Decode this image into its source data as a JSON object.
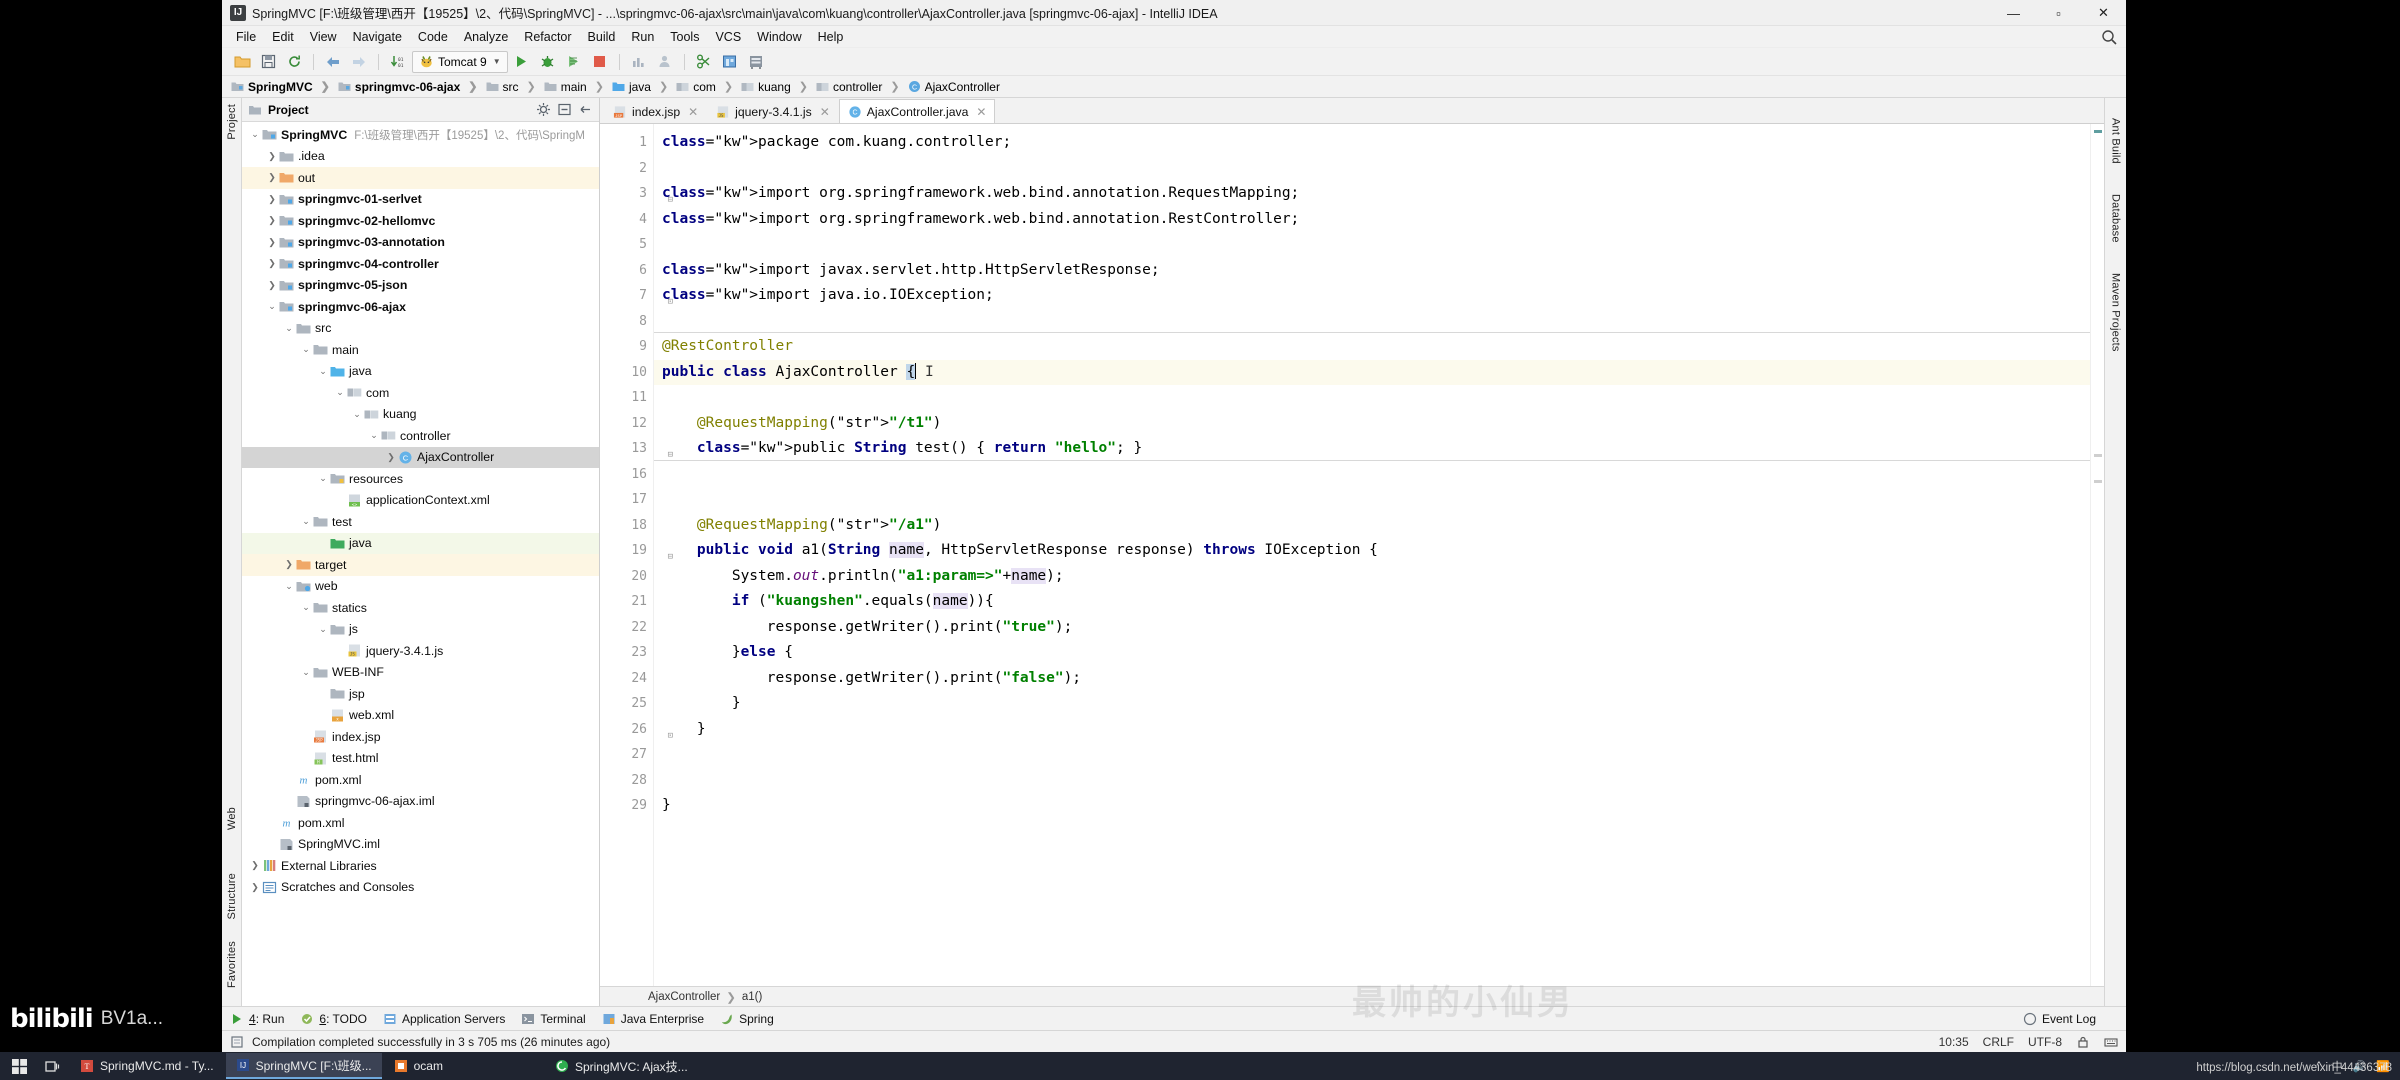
{
  "window": {
    "title": "SpringMVC [F:\\班级管理\\西开【19525】\\2、代码\\SpringMVC] - ...\\springmvc-06-ajax\\src\\main\\java\\com\\kuang\\controller\\AjaxController.java [springmvc-06-ajax] - IntelliJ IDEA",
    "icon_text": "IJ",
    "minimize": "—",
    "maximize": "▫",
    "close": "✕"
  },
  "menu": {
    "items": [
      "File",
      "Edit",
      "View",
      "Navigate",
      "Code",
      "Analyze",
      "Refactor",
      "Build",
      "Run",
      "Tools",
      "VCS",
      "Window",
      "Help"
    ],
    "search_icon": "search-icon"
  },
  "toolbar": {
    "buttons": [
      {
        "name": "open-folder-icon",
        "glyph": "folder"
      },
      {
        "name": "save-all-icon",
        "glyph": "save"
      },
      {
        "name": "sync-refresh-icon",
        "glyph": "sync"
      },
      {
        "name": "back-arrow-icon",
        "glyph": "back"
      },
      {
        "name": "forward-arrow-icon",
        "glyph": "forward"
      },
      {
        "name": "update-project-icon",
        "glyph": "update"
      }
    ],
    "run_config": "Tomcat 9",
    "run_config_icon": "tomcat-cat-icon",
    "actions": [
      {
        "name": "run-button",
        "glyph": "run"
      },
      {
        "name": "debug-button",
        "glyph": "debug"
      },
      {
        "name": "run-with-coverage-button",
        "glyph": "coverage"
      },
      {
        "name": "stop-button",
        "glyph": "stop"
      },
      {
        "name": "profiler-button",
        "glyph": "profile"
      },
      {
        "name": "attach-profiler-button",
        "glyph": "attach"
      },
      {
        "name": "vcs-update-button",
        "glyph": "vcsupdate"
      },
      {
        "name": "commit-button",
        "glyph": "commit"
      },
      {
        "name": "database-button",
        "glyph": "db"
      }
    ]
  },
  "navbar": {
    "crumbs": [
      {
        "label": "SpringMVC",
        "icon": "module-icon",
        "bold": true
      },
      {
        "label": "springmvc-06-ajax",
        "icon": "module-icon",
        "bold": true
      },
      {
        "label": "src",
        "icon": "folder-icon",
        "bold": false
      },
      {
        "label": "main",
        "icon": "folder-icon",
        "bold": false
      },
      {
        "label": "java",
        "icon": "source-folder-icon",
        "bold": false
      },
      {
        "label": "com",
        "icon": "package-icon",
        "bold": false
      },
      {
        "label": "kuang",
        "icon": "package-icon",
        "bold": false
      },
      {
        "label": "controller",
        "icon": "package-icon",
        "bold": false
      },
      {
        "label": "AjaxController",
        "icon": "java-class-icon",
        "bold": false
      }
    ]
  },
  "left_strips": {
    "top": [
      "Project"
    ],
    "bottom": [
      "Structure",
      "Favorites"
    ],
    "web_label": "Web"
  },
  "right_strip": {
    "items": [
      "Ant Build",
      "Database",
      "Maven Projects"
    ]
  },
  "project_panel": {
    "title": "Project",
    "buttons": [
      "settings-icon",
      "collapse-all-icon",
      "hide-icon"
    ],
    "tree": [
      {
        "depth": 0,
        "twisty": "open",
        "icon": "module-icon",
        "label": "SpringMVC",
        "bold": true,
        "path": "F:\\班级管理\\西开【19525】\\2、代码\\SpringM"
      },
      {
        "depth": 1,
        "twisty": "closed",
        "icon": "folder-icon",
        "label": ".idea",
        "bold": false
      },
      {
        "depth": 1,
        "twisty": "closed",
        "icon": "excluded-folder-icon",
        "label": "out",
        "bold": false,
        "hl": "orange"
      },
      {
        "depth": 1,
        "twisty": "closed",
        "icon": "module-icon",
        "label": "springmvc-01-serlvet",
        "bold": true
      },
      {
        "depth": 1,
        "twisty": "closed",
        "icon": "module-icon",
        "label": "springmvc-02-hellomvc",
        "bold": true
      },
      {
        "depth": 1,
        "twisty": "closed",
        "icon": "module-icon",
        "label": "springmvc-03-annotation",
        "bold": true
      },
      {
        "depth": 1,
        "twisty": "closed",
        "icon": "module-icon",
        "label": "springmvc-04-controller",
        "bold": true
      },
      {
        "depth": 1,
        "twisty": "closed",
        "icon": "module-icon",
        "label": "springmvc-05-json",
        "bold": true
      },
      {
        "depth": 1,
        "twisty": "open",
        "icon": "module-icon",
        "label": "springmvc-06-ajax",
        "bold": true
      },
      {
        "depth": 2,
        "twisty": "open",
        "icon": "folder-icon",
        "label": "src",
        "bold": false
      },
      {
        "depth": 3,
        "twisty": "open",
        "icon": "folder-icon",
        "label": "main",
        "bold": false
      },
      {
        "depth": 4,
        "twisty": "open",
        "icon": "source-folder-icon",
        "label": "java",
        "bold": false
      },
      {
        "depth": 5,
        "twisty": "open",
        "icon": "package-icon",
        "label": "com",
        "bold": false
      },
      {
        "depth": 6,
        "twisty": "open",
        "icon": "package-icon",
        "label": "kuang",
        "bold": false
      },
      {
        "depth": 7,
        "twisty": "open",
        "icon": "package-icon",
        "label": "controller",
        "bold": false
      },
      {
        "depth": 8,
        "twisty": "closed",
        "icon": "java-class-icon",
        "label": "AjaxController",
        "bold": false,
        "selected": true
      },
      {
        "depth": 4,
        "twisty": "open",
        "icon": "resource-folder-icon",
        "label": "resources",
        "bold": false
      },
      {
        "depth": 5,
        "twisty": "none",
        "icon": "xml-spring-icon",
        "label": "applicationContext.xml",
        "bold": false
      },
      {
        "depth": 3,
        "twisty": "open",
        "icon": "folder-icon",
        "label": "test",
        "bold": false
      },
      {
        "depth": 4,
        "twisty": "none",
        "icon": "test-source-folder-icon",
        "label": "java",
        "bold": false,
        "hl": "green"
      },
      {
        "depth": 2,
        "twisty": "closed",
        "icon": "excluded-folder-icon",
        "label": "target",
        "bold": false,
        "hl": "orange"
      },
      {
        "depth": 2,
        "twisty": "open",
        "icon": "web-folder-icon",
        "label": "web",
        "bold": false
      },
      {
        "depth": 3,
        "twisty": "open",
        "icon": "folder-icon",
        "label": "statics",
        "bold": false
      },
      {
        "depth": 4,
        "twisty": "open",
        "icon": "folder-icon",
        "label": "js",
        "bold": false
      },
      {
        "depth": 5,
        "twisty": "none",
        "icon": "js-file-icon",
        "label": "jquery-3.4.1.js",
        "bold": false
      },
      {
        "depth": 3,
        "twisty": "open",
        "icon": "folder-icon",
        "label": "WEB-INF",
        "bold": false
      },
      {
        "depth": 4,
        "twisty": "none",
        "icon": "folder-icon",
        "label": "jsp",
        "bold": false
      },
      {
        "depth": 4,
        "twisty": "none",
        "icon": "xml-file-icon",
        "label": "web.xml",
        "bold": false
      },
      {
        "depth": 3,
        "twisty": "none",
        "icon": "jsp-file-icon",
        "label": "index.jsp",
        "bold": false
      },
      {
        "depth": 3,
        "twisty": "none",
        "icon": "html-file-icon",
        "label": "test.html",
        "bold": false
      },
      {
        "depth": 2,
        "twisty": "none",
        "icon": "maven-pom-icon",
        "label": "pom.xml",
        "bold": false
      },
      {
        "depth": 2,
        "twisty": "none",
        "icon": "iml-file-icon",
        "label": "springmvc-06-ajax.iml",
        "bold": false
      },
      {
        "depth": 1,
        "twisty": "none",
        "icon": "maven-pom-icon",
        "label": "pom.xml",
        "bold": false
      },
      {
        "depth": 1,
        "twisty": "none",
        "icon": "iml-file-icon",
        "label": "SpringMVC.iml",
        "bold": false
      },
      {
        "depth": 0,
        "twisty": "closed",
        "icon": "external-libraries-icon",
        "label": "External Libraries",
        "bold": false
      },
      {
        "depth": 0,
        "twisty": "closed",
        "icon": "scratches-icon",
        "label": "Scratches and Consoles",
        "bold": false
      }
    ]
  },
  "editor": {
    "tabs": [
      {
        "label": "index.jsp",
        "icon": "jsp-file-icon",
        "active": false
      },
      {
        "label": "jquery-3.4.1.js",
        "icon": "js-file-icon",
        "active": false
      },
      {
        "label": "AjaxController.java",
        "icon": "java-class-icon",
        "active": true
      }
    ],
    "line_numbers": [
      "1",
      "2",
      "3",
      "4",
      "5",
      "6",
      "7",
      "8",
      "9",
      "10",
      "11",
      "12",
      "13",
      "16",
      "17",
      "18",
      "19",
      "20",
      "21",
      "22",
      "23",
      "24",
      "25",
      "26",
      "27",
      "28",
      "29"
    ],
    "lines": [
      "package com.kuang.controller;",
      "",
      "import org.springframework.web.bind.annotation.RequestMapping;",
      "import org.springframework.web.bind.annotation.RestController;",
      "",
      "import javax.servlet.http.HttpServletResponse;",
      "import java.io.IOException;",
      "",
      "@RestController",
      "public class AjaxController {",
      "",
      "    @RequestMapping(\"/t1\")",
      "    public String test() { return \"hello\"; }",
      "",
      "",
      "    @RequestMapping(\"/a1\")",
      "    public void a1(String name, HttpServletResponse response) throws IOException {",
      "        System.out.println(\"a1:param=>\"+name);",
      "        if (\"kuangshen\".equals(name)){",
      "            response.getWriter().print(\"true\");",
      "        }else {",
      "            response.getWriter().print(\"false\");",
      "        }",
      "    }",
      "",
      "",
      "}"
    ],
    "caret_line_index": 9,
    "footer_crumbs": [
      "AjaxController",
      "a1()"
    ],
    "run_marker_line": "10"
  },
  "tool_windows": {
    "items": [
      {
        "num": "4",
        "label": "Run",
        "icon": "run-icon"
      },
      {
        "num": "6",
        "label": "TODO",
        "icon": "todo-icon"
      },
      {
        "num": "",
        "label": "Application Servers",
        "icon": "app-servers-icon"
      },
      {
        "num": "",
        "label": "Terminal",
        "icon": "terminal-icon"
      },
      {
        "num": "",
        "label": "Java Enterprise",
        "icon": "java-ee-icon"
      },
      {
        "num": "",
        "label": "Spring",
        "icon": "spring-leaf-icon"
      }
    ],
    "event_log": "Event Log"
  },
  "status_bar": {
    "message": "Compilation completed successfully in 3 s 705 ms (26 minutes ago)",
    "icon": "build-icon",
    "caret_position": "10:35",
    "line_separator": "CRLF",
    "encoding": "UTF-8",
    "indent": "4",
    "lock_icon": "lock-icon"
  },
  "taskbar": {
    "start_icon": "windows-start-icon",
    "task_view_icon": "task-view-icon",
    "items": [
      {
        "label": "SpringMVC.md - Ty...",
        "icon": "typora-icon",
        "active": false
      },
      {
        "label": "SpringMVC [F:\\班级...",
        "icon": "intellij-icon",
        "active": true
      },
      {
        "label": "ocam",
        "icon": "ocam-icon",
        "active": false
      },
      {
        "label": "SpringMVC: Ajax技...",
        "icon": "browser-icon",
        "active": false
      }
    ],
    "tray": [
      "^",
      "中",
      "🔊",
      "📶"
    ]
  },
  "overlays": {
    "bilibili_logo": "bilibili",
    "bilibili_bv": "BV1a...",
    "csdn_url": "https://blog.csdn.net/weixin_44436378",
    "ghost_text": "最帅的小仙男"
  },
  "colors": {
    "keyword": "#000080",
    "string": "#008000",
    "annotation": "#808000",
    "field": "#660e7a",
    "selection": "#c0d6ea",
    "current_line": "#fcfaed",
    "accent": "#3b4254"
  }
}
